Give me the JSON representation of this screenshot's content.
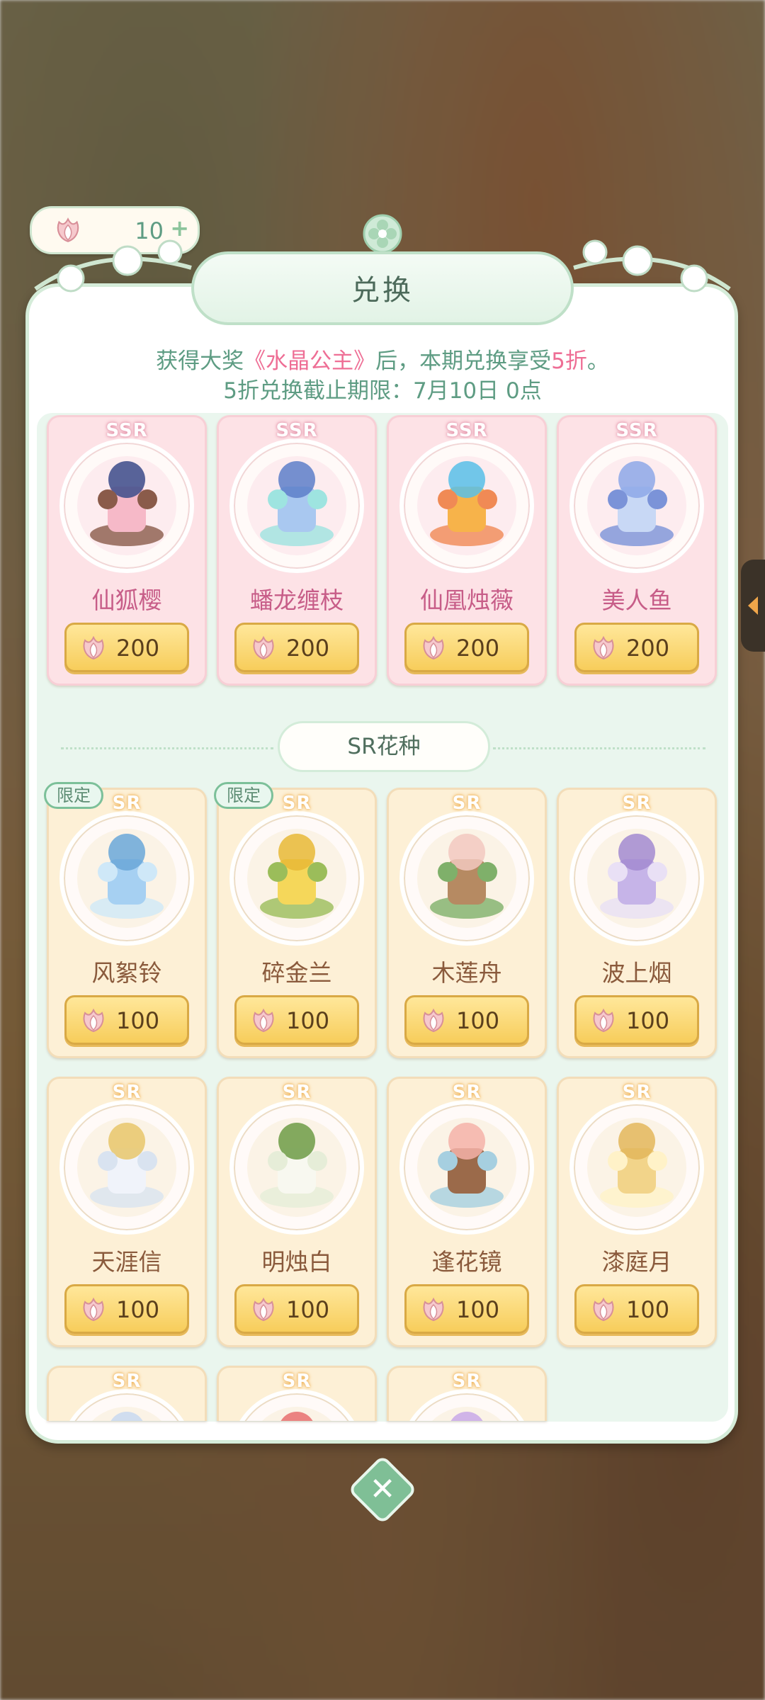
{
  "currency": {
    "amount": "10",
    "plus": "+"
  },
  "header": {
    "title": "兑换"
  },
  "notice": {
    "line1_prefix": "获得大奖",
    "line1_highlight": "《水晶公主》",
    "line1_middle": "后，本期兑换享受",
    "line1_discount": "5折",
    "line1_suffix": "。",
    "line2": "5折兑换截止期限：7月10日 0点"
  },
  "ssr_items": [
    {
      "rarity": "SSR",
      "name": "仙狐樱",
      "price": "200"
    },
    {
      "rarity": "SSR",
      "name": "蟠龙缠枝",
      "price": "200"
    },
    {
      "rarity": "SSR",
      "name": "仙凰烛薇",
      "price": "200"
    },
    {
      "rarity": "SSR",
      "name": "美人鱼",
      "price": "200"
    }
  ],
  "section": {
    "label": "SR花种"
  },
  "sr_items": [
    {
      "rarity": "SR",
      "name": "风絮铃",
      "price": "100",
      "tag": "限定"
    },
    {
      "rarity": "SR",
      "name": "碎金兰",
      "price": "100",
      "tag": "限定"
    },
    {
      "rarity": "SR",
      "name": "木莲舟",
      "price": "100"
    },
    {
      "rarity": "SR",
      "name": "波上烟",
      "price": "100"
    },
    {
      "rarity": "SR",
      "name": "天涯信",
      "price": "100"
    },
    {
      "rarity": "SR",
      "name": "明烛白",
      "price": "100"
    },
    {
      "rarity": "SR",
      "name": "逢花镜",
      "price": "100"
    },
    {
      "rarity": "SR",
      "name": "漆庭月",
      "price": "100"
    },
    {
      "rarity": "SR"
    },
    {
      "rarity": "SR"
    },
    {
      "rarity": "SR"
    }
  ],
  "colors": {
    "accent_green": "#5e9c83",
    "accent_pink": "#ee6e95",
    "ssr_card": "#fde2e6",
    "sr_card": "#fdf0d6",
    "price_button": "#f7cd5b"
  }
}
